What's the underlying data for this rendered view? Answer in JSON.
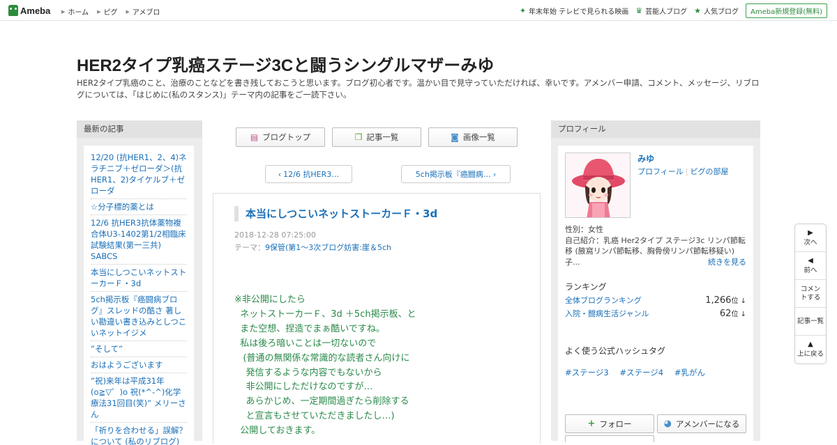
{
  "header": {
    "logo_text": "Ameba",
    "nav": [
      "ホーム",
      "ピグ",
      "アメブロ"
    ],
    "right_links": [
      {
        "icon": "sparkle-icon",
        "label": "年末年始 テレビで見られる映画"
      },
      {
        "icon": "crown-icon",
        "label": "芸能人ブログ"
      },
      {
        "icon": "star-icon",
        "label": "人気ブログ"
      }
    ],
    "register_label": "Ameba新規登録(無料)"
  },
  "blog": {
    "title": "HER2タイプ乳癌ステージ3Cと闘うシングルマザーみゆ",
    "description": "HER2タイプ乳癌のこと、治療のことなどを書き残しておこうと思います。ブログ初心者です。温かい目で見守っていただければ、幸いです。アメンバー申請、コメント、メッセージ、リブログについては、「はじめに(私のスタンス)」テーマ内の記事をご一読下さい。"
  },
  "left": {
    "heading": "最新の記事",
    "items": [
      "12/20 (抗HER1、2、4)ネラチニブ＋ゼローダ＞(抗HER1、2)タイケルブ＋ゼローダ",
      "☆分子標的薬とは",
      "12/6 抗HER3抗体薬物複合体U3-1402第1/2相臨床試験結果(第一三共) SABCS",
      "本当にしつこいネットストーカーＦ・3d",
      "5ch掲示板『癌闘病ブログ』スレッドの酷さ 著しい勘違い書き込みとしつこいネットイジメ",
      "”そして”",
      "おはようございます",
      "”祝)来年は平成31年 (o≧▽゜)o 祝(*^-^)化学療法31回目(笑)” メリーさん",
      "「祈りを合わせる」誤解？について (私のリブログ)"
    ]
  },
  "main": {
    "tabs": [
      {
        "icon": "document-icon",
        "label": "ブログトップ"
      },
      {
        "icon": "copy-icon",
        "label": "記事一覧"
      },
      {
        "icon": "camera-icon",
        "label": "画像一覧"
      }
    ],
    "prev_label": "12/6 抗HER3…",
    "next_label": "5ch掲示板『癌闘病…",
    "article": {
      "title": "本当にしつこいネットストーカーＦ・3d",
      "date": "2018-12-28 07:25:00",
      "theme_prefix": "テーマ：",
      "theme": "9保管(第1～3次ブログ妨害:崖＆5ch",
      "body": "※非公開にしたら\n  ネットストーカーＦ、3d ＋5ch掲示板、と\n  また空想、捏造でまぁ酷いですね。\n  私は後ろ暗いことは一切ないので\n   (普通の無関係な常識的な読者さん向けに\n    発信するような内容でもないから\n    非公開にしただけなのですが…\n    あらかじめ、一定期間過ぎたら削除する\n    と宣言もさせていただきましたし…)\n  公開しておきます。"
    }
  },
  "profile": {
    "heading": "プロフィール",
    "name": "みゆ",
    "link_profile": "プロフィール",
    "link_pigg": "ピグの部屋",
    "gender": "性別：女性",
    "intro": "自己紹介：乳癌 Her2タイプ ステージ3c リンパ節転移 (腋窩リンパ節転移、胸骨傍リンパ節転移疑い) 子...",
    "more_label": "続きを見る",
    "ranking_heading": "ランキング",
    "rankings": [
      {
        "label": "全体ブログランキング",
        "value": "1,266",
        "unit": "位 ↓"
      },
      {
        "label": "入院・闘病生活ジャンル",
        "value": "62",
        "unit": "位 ↓"
      }
    ],
    "hashtag_heading": "よく使う公式ハッシュタグ",
    "hashtags": [
      "#ステージ3",
      "#ステージ4",
      "#乳がん"
    ],
    "follow_label": "フォロー",
    "amember_label": "アメンバーになる"
  },
  "sidenav": [
    {
      "icon": "arrow-right-icon",
      "label": "次へ"
    },
    {
      "icon": "arrow-left-icon",
      "label": "前へ"
    },
    {
      "icon": "comment-icon",
      "label": "コメントする"
    },
    {
      "icon": "list-icon",
      "label": "記事一覧"
    },
    {
      "icon": "arrow-up-icon",
      "label": "上に戻る"
    }
  ],
  "colors": {
    "accent_green": "#2d8c3c",
    "link_blue": "#1a6fb8",
    "body_green": "#2a8a4a"
  }
}
